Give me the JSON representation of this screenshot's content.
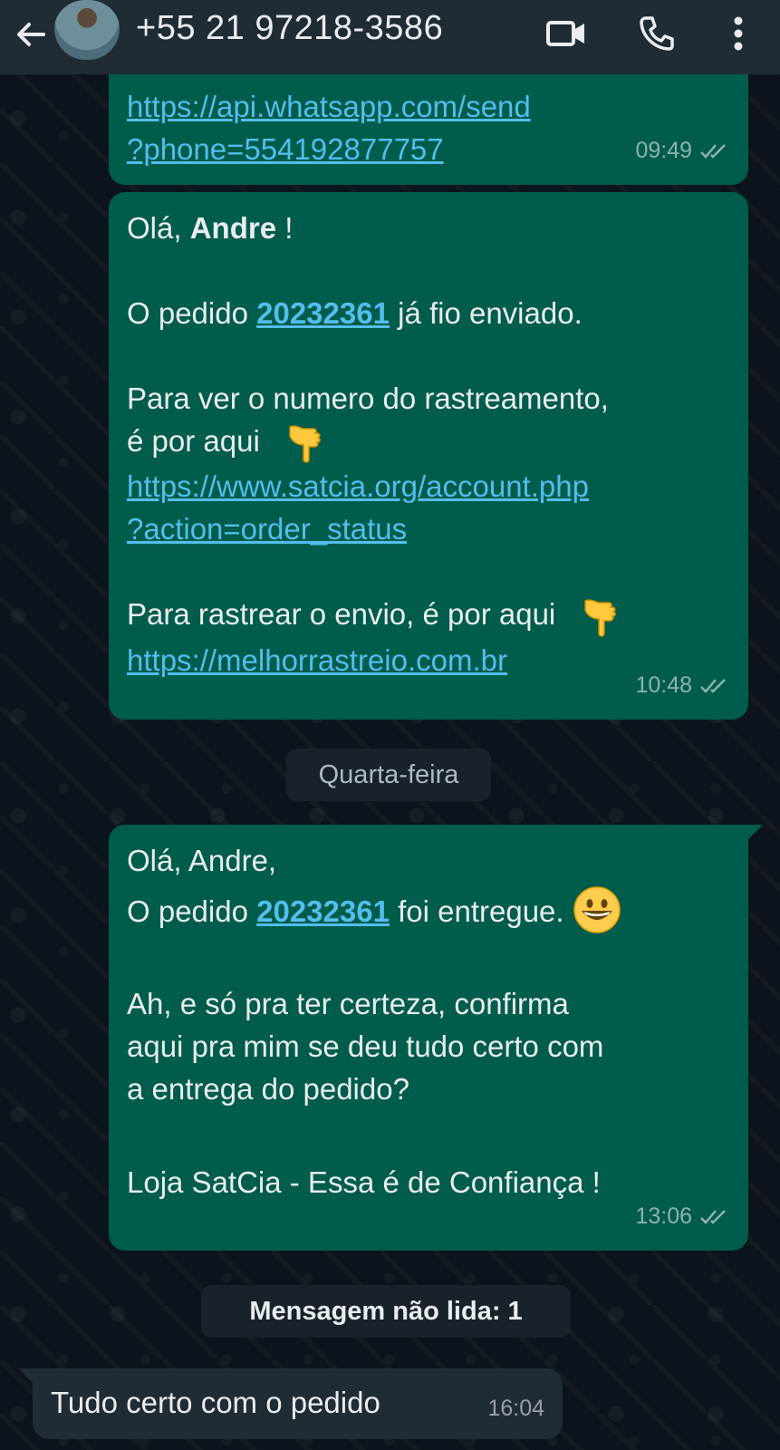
{
  "header": {
    "title": "+55 21 97218-3586",
    "icons": [
      "back-arrow-icon",
      "avatar",
      "video-call-icon",
      "voice-call-icon",
      "more-options-icon"
    ]
  },
  "messages": [
    {
      "link_lines": [
        "https://api.whatsapp.com/send",
        "?phone=554192877757"
      ],
      "time": "09:49"
    },
    {
      "greeting_prefix": "Olá, ",
      "greeting_name": "Andre",
      "greeting_suffix": " !",
      "order_prefix": "O pedido ",
      "order_number": "20232361",
      "order_suffix": " já fio enviado.",
      "tracking_line1": "Para ver o numero do rastreamento,",
      "tracking_line2": "é por aqui",
      "tracking_link_line1": "https://www.satcia.org/account.php",
      "tracking_link_line2": "?action=order_status",
      "ship_line": "Para rastrear o envio, é por aqui",
      "ship_link": "https://melhorrastreio.com.br",
      "time": "10:48"
    },
    {
      "greeting": "Olá, Andre,",
      "order_prefix": "O pedido ",
      "order_number": "20232361",
      "order_suffix": " foi entregue.",
      "confirm_line1": "Ah, e só pra ter certeza, confirma",
      "confirm_line2": "aqui pra mim se deu tudo certo com",
      "confirm_line3": "a entrega do pedido?",
      "signature": "Loja SatCia - Essa é de Confiança !",
      "time": "13:06"
    },
    {
      "text": "Tudo certo com o pedido",
      "time": "16:04"
    }
  ],
  "date_chip": "Quarta-feira",
  "unread_chip": "Mensagem não lida: 1",
  "colors": {
    "background": "#0b141a",
    "header": "#1f2c34",
    "outgoing_bubble": "#005c4b",
    "incoming_bubble": "#1f2c34",
    "link": "#53bdeb"
  }
}
